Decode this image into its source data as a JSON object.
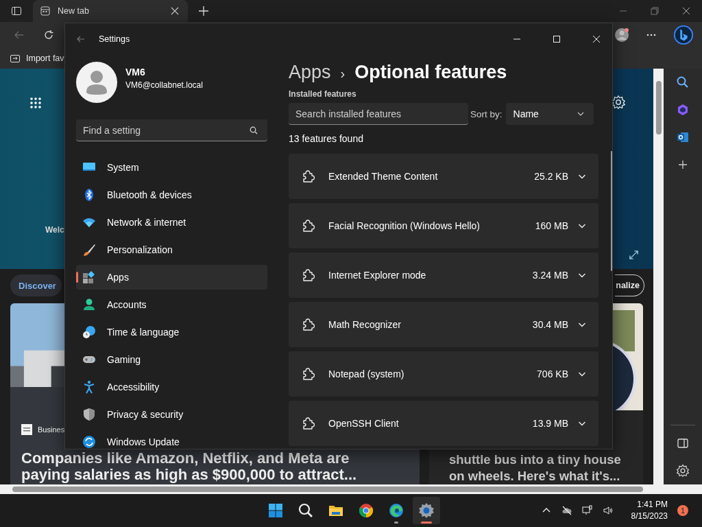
{
  "browser": {
    "tab": {
      "title": "New tab",
      "selected": true
    },
    "favorites": [
      "Import fav"
    ],
    "hero": {
      "welcome": "Welc"
    },
    "feed": {
      "discover": "Discover",
      "personalize": "nalize"
    },
    "left_card": {
      "source": "Busines",
      "headline": [
        "Companies like Amazon, Netflix, and Meta are",
        "paying salaries as high as $900,000 to attract..."
      ]
    },
    "right_card": {
      "headline": [
        "shuttle bus into a tiny house",
        "on wheels. Here's what it's..."
      ]
    }
  },
  "settings": {
    "title": "Settings",
    "user": {
      "name": "VM6",
      "email": "VM6@collabnet.local"
    },
    "search": {
      "placeholder": "Find a setting"
    },
    "nav": [
      {
        "label": "System",
        "selected": false
      },
      {
        "label": "Bluetooth & devices",
        "selected": false
      },
      {
        "label": "Network & internet",
        "selected": false
      },
      {
        "label": "Personalization",
        "selected": false
      },
      {
        "label": "Apps",
        "selected": true
      },
      {
        "label": "Accounts",
        "selected": false
      },
      {
        "label": "Time & language",
        "selected": false
      },
      {
        "label": "Gaming",
        "selected": false
      },
      {
        "label": "Accessibility",
        "selected": false
      },
      {
        "label": "Privacy & security",
        "selected": false
      },
      {
        "label": "Windows Update",
        "selected": false
      }
    ],
    "breadcrumb": {
      "parent": "Apps",
      "separator": "›",
      "current": "Optional features"
    },
    "section": "Installed features",
    "feature_search": {
      "placeholder": "Search installed features"
    },
    "sort": {
      "label": "Sort by:",
      "value": "Name"
    },
    "count": "13 features found",
    "features": [
      {
        "name": "Extended Theme Content",
        "size": "25.2 KB"
      },
      {
        "name": "Facial Recognition (Windows Hello)",
        "size": "160 MB"
      },
      {
        "name": "Internet Explorer mode",
        "size": "3.24 MB"
      },
      {
        "name": "Math Recognizer",
        "size": "30.4 MB"
      },
      {
        "name": "Notepad (system)",
        "size": "706 KB"
      },
      {
        "name": "OpenSSH Client",
        "size": "13.9 MB"
      }
    ]
  },
  "taskbar": {
    "apps": [
      {
        "kind": "start",
        "selected": false,
        "running": false
      },
      {
        "kind": "search",
        "selected": false,
        "running": false
      },
      {
        "kind": "explorer",
        "selected": false,
        "running": false
      },
      {
        "kind": "chrome",
        "selected": false,
        "running": false
      },
      {
        "kind": "edge",
        "selected": false,
        "running": true
      },
      {
        "kind": "settings",
        "selected": true,
        "running": true
      }
    ],
    "time": "1:41 PM",
    "date": "8/15/2023",
    "notifications": "1"
  }
}
